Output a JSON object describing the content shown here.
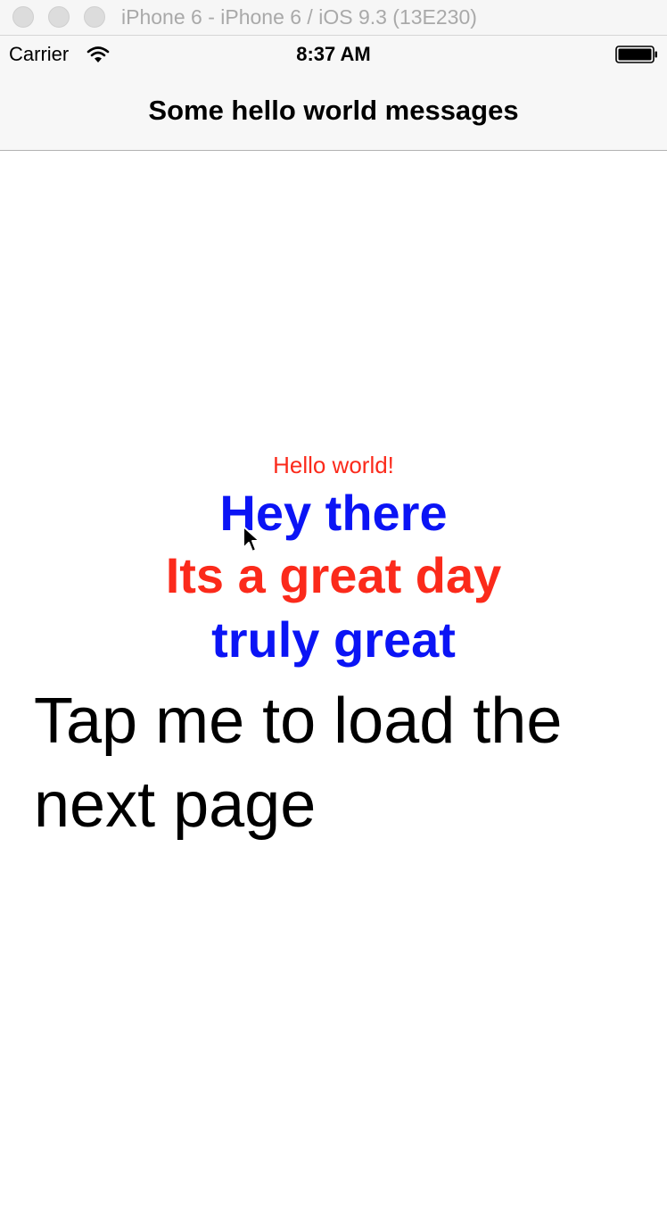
{
  "window": {
    "title": "iPhone 6 - iPhone 6 / iOS 9.3 (13E230)",
    "controls": [
      "close-button",
      "minimize-button",
      "zoom-button"
    ]
  },
  "status_bar": {
    "carrier": "Carrier",
    "time": "8:37 AM",
    "icons": [
      "wifi-icon",
      "battery-icon"
    ]
  },
  "nav_bar": {
    "title": "Some hello world messages"
  },
  "messages": {
    "hello": "Hello world!",
    "hey": "Hey there",
    "great_day": "Its a great day",
    "truly": "truly great"
  },
  "link": {
    "label": "Tap me to load the next page"
  },
  "colors": {
    "red": "#fb2a1b",
    "blue": "#0b14f5",
    "text": "#000000",
    "bar_background": "#f7f7f7"
  }
}
